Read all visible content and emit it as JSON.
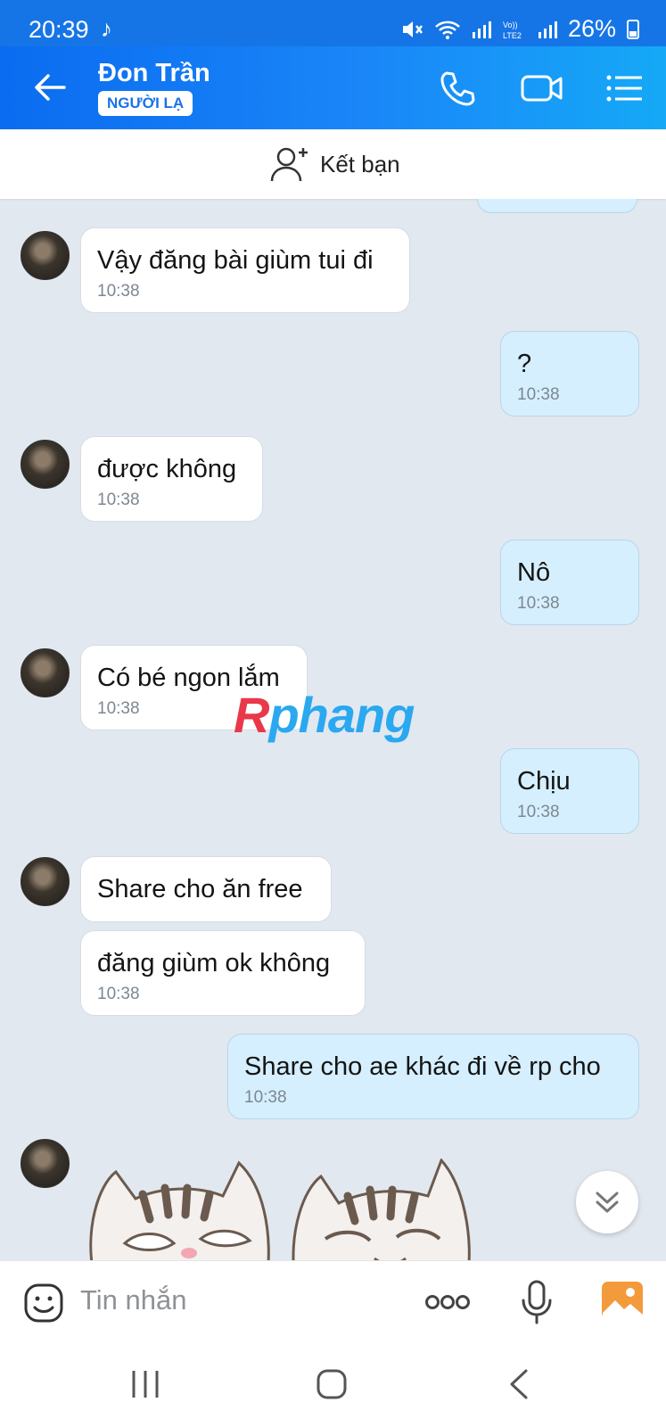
{
  "status_bar": {
    "time": "20:39",
    "battery": "26%"
  },
  "header": {
    "contact_name": "Đon Trần",
    "badge": "NGƯỜI LẠ"
  },
  "friend_bar": {
    "label": "Kết bạn"
  },
  "messages": [
    {
      "from": "them",
      "text": "Vậy đăng bài giùm tui đi",
      "time": "10:38"
    },
    {
      "from": "me",
      "text": "?",
      "time": "10:38"
    },
    {
      "from": "them",
      "text": "được không",
      "time": "10:38"
    },
    {
      "from": "me",
      "text": "Nô",
      "time": "10:38"
    },
    {
      "from": "them",
      "text": "Có bé ngon lắm",
      "time": "10:38"
    },
    {
      "from": "me",
      "text": "Chịu",
      "time": "10:38"
    },
    {
      "from": "them",
      "text": "Share cho ăn free",
      "time": ""
    },
    {
      "from": "them",
      "text": "đăng giùm ok không",
      "time": "10:38"
    },
    {
      "from": "me",
      "text": "Share cho ae khác đi về rp cho",
      "time": "10:38"
    }
  ],
  "watermark": {
    "r": "R",
    "rest": "phang"
  },
  "composer": {
    "placeholder": "Tin nhắn"
  },
  "colors": {
    "accent": "#1a86f8",
    "my_bubble": "#d5effe",
    "chat_bg": "#e2e8ef"
  }
}
